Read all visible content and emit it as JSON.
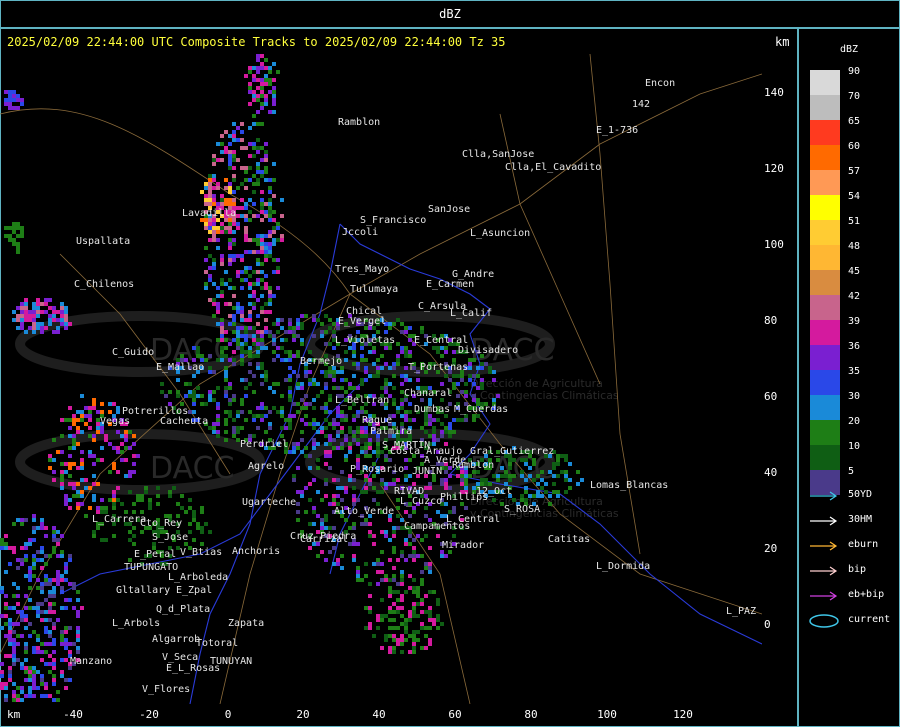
{
  "window": {
    "title": "dBZ"
  },
  "header": {
    "text": "2025/02/09 22:44:00 UTC Composite Tracks to 2025/02/09 22:44:00 Tz 35",
    "km_label": "km"
  },
  "axes": {
    "x_label": "km",
    "y_label": "km",
    "x_ticks": [
      "-40",
      "-20",
      "0",
      "20",
      "40",
      "60",
      "80",
      "100",
      "120"
    ],
    "y_ticks": [
      "140",
      "120",
      "100",
      "80",
      "60",
      "40",
      "20",
      "0"
    ]
  },
  "legend": {
    "title": "dBZ",
    "levels": [
      {
        "label": "90",
        "color": "#d9d9d9"
      },
      {
        "label": "70",
        "color": "#bdbdbd"
      },
      {
        "label": "65",
        "color": "#ff3a1f"
      },
      {
        "label": "60",
        "color": "#ff6a00"
      },
      {
        "label": "57",
        "color": "#ff9955"
      },
      {
        "label": "54",
        "color": "#ffff00"
      },
      {
        "label": "51",
        "color": "#ffcc33"
      },
      {
        "label": "48",
        "color": "#ffb733"
      },
      {
        "label": "45",
        "color": "#d98c40"
      },
      {
        "label": "42",
        "color": "#c8648c"
      },
      {
        "label": "39",
        "color": "#d41a9e"
      },
      {
        "label": "36",
        "color": "#7a1fd1"
      },
      {
        "label": "35",
        "color": "#2a48e8"
      },
      {
        "label": "30",
        "color": "#1a8ad8"
      },
      {
        "label": "20",
        "color": "#1e7e16"
      },
      {
        "label": "10",
        "color": "#0f5e14"
      },
      {
        "label": "5",
        "color": "#4a3a8a"
      }
    ],
    "tracks": [
      {
        "label": "50YD",
        "color": "#3fc6e8"
      },
      {
        "label": "30HM",
        "color": "#ffffff"
      },
      {
        "label": "eburn",
        "color": "#ffb733"
      },
      {
        "label": "bip",
        "color": "#ffd0d0"
      },
      {
        "label": "eb+bip",
        "color": "#d040e0"
      },
      {
        "label": "current",
        "color": "#3fc6e8"
      }
    ]
  },
  "map": {
    "watermark": [
      "DACC",
      "DACC",
      "DACC",
      "DACC",
      "Dirección de Agricultura",
      "y Contingencias Climáticas",
      "Dirección de Agricultura",
      "y Contingencias Climáticas"
    ],
    "towns": [
      "Encon",
      "Ramblon",
      "E_1-736",
      "Clla,SanJose",
      "Clla,El_Cavadito",
      "S_Francisco",
      "Jccoli",
      "SanJose",
      "L_Asuncion",
      "Uspallata",
      "Lavadilla",
      "Tres_Mayo",
      "G_Andre",
      "Tulumaya",
      "E_Carmen",
      "C_Chilenos",
      "Chical",
      "E_Vergel",
      "C_Arsula",
      "L_Calif",
      "C_Guido",
      "L_Violetas",
      "E_Central",
      "Divisadero",
      "E_Mallao",
      "Bermejo",
      "T_Portenas",
      "Chanaral",
      "L_Beltran",
      "Rague",
      "Dumbas",
      "M_Cuerdas",
      "Potrerillos",
      "Cacheuta",
      "Vegas",
      "S_MARTIN",
      "Palmira",
      "Perdriel",
      "Agrelo",
      "A_Verde",
      "Ramblon",
      "P_Rosario",
      "JUNIN",
      "RIVAD",
      "Phillips",
      "12_Oct",
      "Lomas_Blancas",
      "Ugarteche",
      "L_Carrera",
      "Cto_Rey",
      "S_Jose",
      "E_Peral",
      "V_Btias",
      "TUPUNGATO",
      "L_Arboleda",
      "Anchoris",
      "Cruz_Piedra",
      "Carrizal",
      "Alto_Verde",
      "Campamentos",
      "L_Central",
      "S_ROSA",
      "Catitas",
      "Mirador",
      "L_Dormida",
      "L_PAZ",
      "Gltallary",
      "E_Zpal",
      "Q_d_Plata",
      "L_Arbols",
      "Zapata",
      "Algarrob",
      "Totoral",
      "V_Seca",
      "Manzano",
      "E_L_Rosas",
      "TUNUYAN",
      "V_Flores",
      "Costa_Araujo",
      "L_Cuzco",
      "Gral_Gutierrez",
      "142"
    ]
  }
}
